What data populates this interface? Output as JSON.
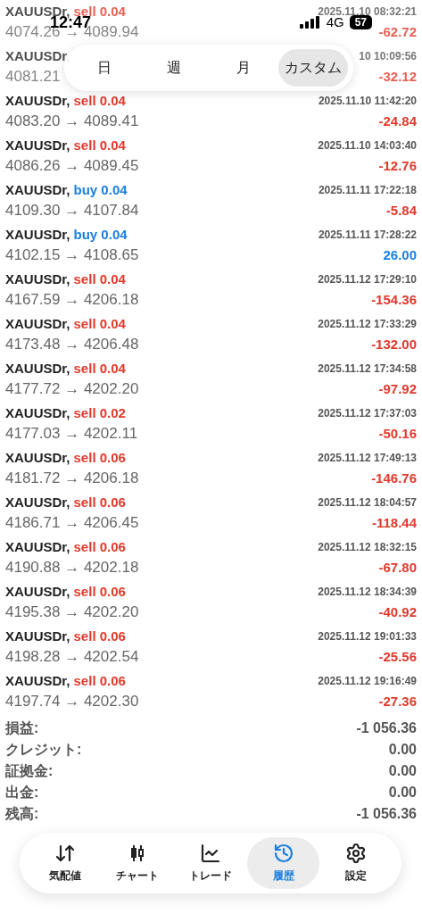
{
  "status_bar": {
    "time": "12:47",
    "network": "4G",
    "battery": "57"
  },
  "period_tabs": [
    {
      "label": "日",
      "selected": false
    },
    {
      "label": "週",
      "selected": false
    },
    {
      "label": "月",
      "selected": false
    },
    {
      "label": "カスタム",
      "selected": true
    }
  ],
  "deals": [
    {
      "symbol": "XAUUSDr,",
      "side": "sell",
      "volume": "0.04",
      "time": "2025.11.10 08:32:21",
      "prices": "4074.26 → 4089.94",
      "profit": "-62.72",
      "gain": false
    },
    {
      "symbol": "XAUUSDr,",
      "time": "10 10:09:56",
      "prices": "4081.21",
      "profit": "-32.12",
      "gain": false
    },
    {
      "symbol": "XAUUSDr,",
      "side": "sell",
      "volume": "0.04",
      "time": "2025.11.10 11:42:20",
      "prices": "4083.20 → 4089.41",
      "profit": "-24.84",
      "gain": false
    },
    {
      "symbol": "XAUUSDr,",
      "side": "sell",
      "volume": "0.04",
      "time": "2025.11.10 14:03:40",
      "prices": "4086.26 → 4089.45",
      "profit": "-12.76",
      "gain": false
    },
    {
      "symbol": "XAUUSDr,",
      "side": "buy",
      "volume": "0.04",
      "time": "2025.11.11 17:22:18",
      "prices": "4109.30 → 4107.84",
      "profit": "-5.84",
      "gain": false
    },
    {
      "symbol": "XAUUSDr,",
      "side": "buy",
      "volume": "0.04",
      "time": "2025.11.11 17:28:22",
      "prices": "4102.15 → 4108.65",
      "profit": "26.00",
      "gain": true
    },
    {
      "symbol": "XAUUSDr,",
      "side": "sell",
      "volume": "0.04",
      "time": "2025.11.12 17:29:10",
      "prices": "4167.59 → 4206.18",
      "profit": "-154.36",
      "gain": false
    },
    {
      "symbol": "XAUUSDr,",
      "side": "sell",
      "volume": "0.04",
      "time": "2025.11.12 17:33:29",
      "prices": "4173.48 → 4206.48",
      "profit": "-132.00",
      "gain": false
    },
    {
      "symbol": "XAUUSDr,",
      "side": "sell",
      "volume": "0.04",
      "time": "2025.11.12 17:34:58",
      "prices": "4177.72 → 4202.20",
      "profit": "-97.92",
      "gain": false
    },
    {
      "symbol": "XAUUSDr,",
      "side": "sell",
      "volume": "0.02",
      "time": "2025.11.12 17:37:03",
      "prices": "4177.03 → 4202.11",
      "profit": "-50.16",
      "gain": false
    },
    {
      "symbol": "XAUUSDr,",
      "side": "sell",
      "volume": "0.06",
      "time": "2025.11.12 17:49:13",
      "prices": "4181.72 → 4206.18",
      "profit": "-146.76",
      "gain": false
    },
    {
      "symbol": "XAUUSDr,",
      "side": "sell",
      "volume": "0.06",
      "time": "2025.11.12 18:04:57",
      "prices": "4186.71 → 4206.45",
      "profit": "-118.44",
      "gain": false
    },
    {
      "symbol": "XAUUSDr,",
      "side": "sell",
      "volume": "0.06",
      "time": "2025.11.12 18:32:15",
      "prices": "4190.88 → 4202.18",
      "profit": "-67.80",
      "gain": false
    },
    {
      "symbol": "XAUUSDr,",
      "side": "sell",
      "volume": "0.06",
      "time": "2025.11.12 18:34:39",
      "prices": "4195.38 → 4202.20",
      "profit": "-40.92",
      "gain": false
    },
    {
      "symbol": "XAUUSDr,",
      "side": "sell",
      "volume": "0.06",
      "time": "2025.11.12 19:01:33",
      "prices": "4198.28 → 4202.54",
      "profit": "-25.56",
      "gain": false
    },
    {
      "symbol": "XAUUSDr,",
      "side": "sell",
      "volume": "0.06",
      "time": "2025.11.12 19:16:49",
      "prices": "4197.74 → 4202.30",
      "profit": "-27.36",
      "gain": false
    }
  ],
  "summary": [
    {
      "label": "損益:",
      "value": "-1 056.36"
    },
    {
      "label": "クレジット:",
      "value": "0.00"
    },
    {
      "label": "証拠金:",
      "value": "0.00"
    },
    {
      "label": "出金:",
      "value": "0.00"
    },
    {
      "label": "残高:",
      "value": "-1 056.36"
    }
  ],
  "nav": [
    {
      "kind": "quotes",
      "label": "気配値",
      "selected": false
    },
    {
      "kind": "chart",
      "label": "チャート",
      "selected": false
    },
    {
      "kind": "trade",
      "label": "トレード",
      "selected": false
    },
    {
      "kind": "history",
      "label": "履歴",
      "selected": true
    },
    {
      "kind": "settings",
      "label": "設定",
      "selected": false
    }
  ]
}
